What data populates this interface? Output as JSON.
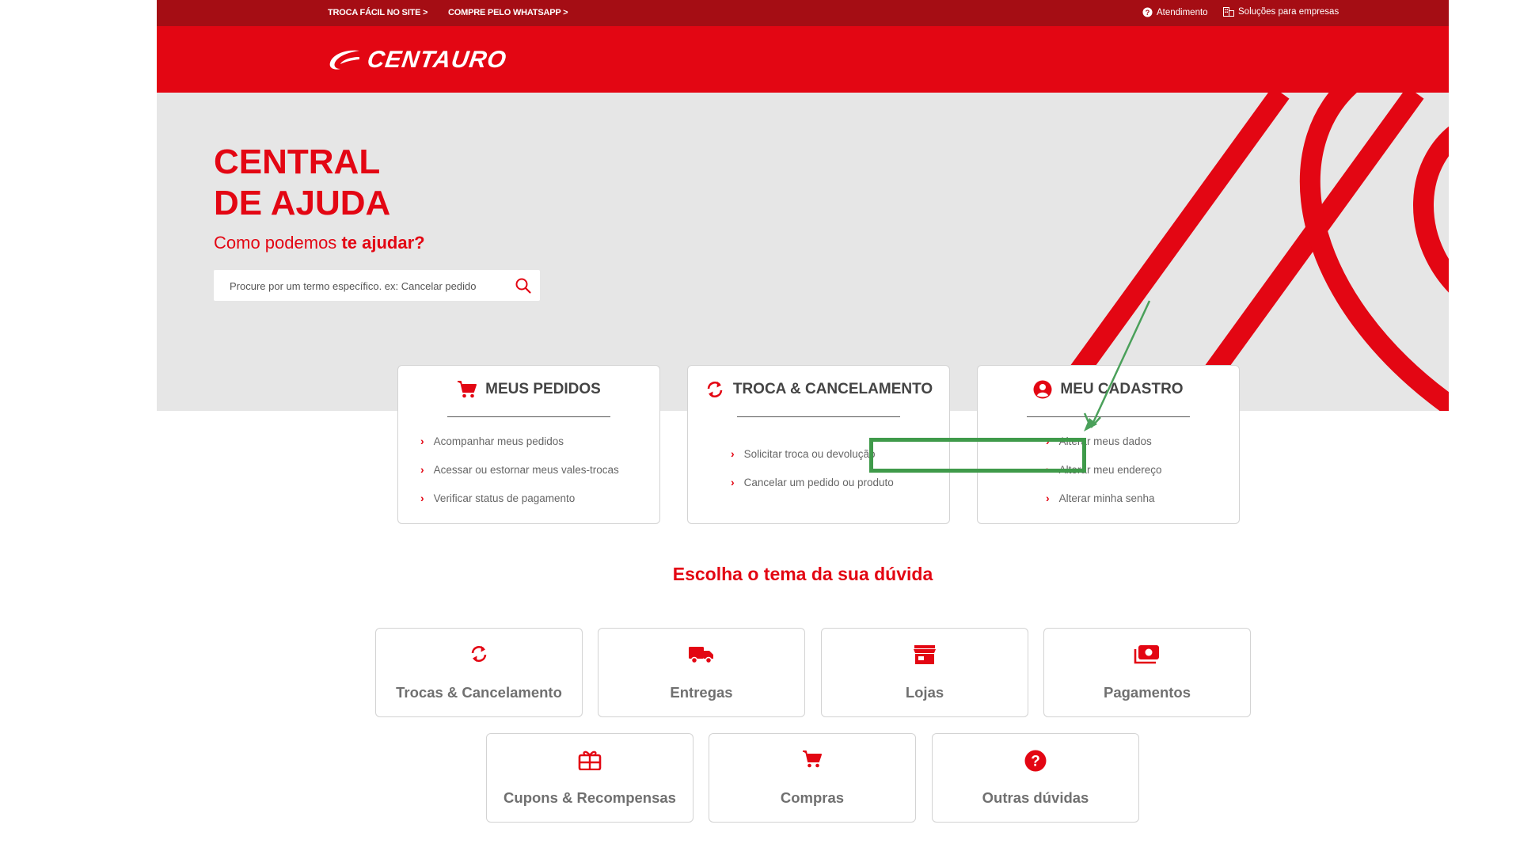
{
  "topbar": {
    "link_troca": "TROCA FÁCIL NO SITE >",
    "link_whatsapp": "COMPRE PELO WHATSAPP >",
    "atendimento": "Atendimento",
    "solucoes": "Soluções para empresas"
  },
  "header": {
    "logo_text": "CENTAURO"
  },
  "hero": {
    "title_line1": "CENTRAL",
    "title_line2": "DE AJUDA",
    "subtitle_prefix": "Como podemos",
    "subtitle_bold": "te ajudar?",
    "search_placeholder": "Procure por um termo específico. ex: Cancelar pedido"
  },
  "quick_cards": [
    {
      "title": "MEUS PEDIDOS",
      "icon": "cart-icon",
      "items": [
        "Acompanhar meus pedidos",
        "Acessar ou estornar meus vales-trocas",
        "Verificar status de pagamento"
      ]
    },
    {
      "title": "TROCA & CANCELAMENTO",
      "icon": "exchange-icon",
      "items": [
        "Solicitar troca ou devolução",
        "Cancelar um pedido ou produto"
      ]
    },
    {
      "title": "MEU CADASTRO",
      "icon": "user-icon",
      "items": [
        "Alterar meus dados",
        "Alterar meu endereço",
        "Alterar minha senha"
      ]
    }
  ],
  "topics": {
    "title": "Escolha o tema da sua dúvida",
    "items": [
      {
        "label": "Trocas & Cancelamento",
        "icon": "exchange-icon"
      },
      {
        "label": "Entregas",
        "icon": "truck-icon"
      },
      {
        "label": "Lojas",
        "icon": "store-icon"
      },
      {
        "label": "Pagamentos",
        "icon": "payment-icon"
      },
      {
        "label": "Cupons & Recompensas",
        "icon": "gift-icon"
      },
      {
        "label": "Compras",
        "icon": "cart-icon"
      },
      {
        "label": "Outras dúvidas",
        "icon": "question-icon"
      }
    ]
  },
  "colors": {
    "brand_red": "#e30613",
    "topbar_red": "#a50d14",
    "highlight_green": "#3f9a4a",
    "hero_bg": "#e6e6e6"
  }
}
